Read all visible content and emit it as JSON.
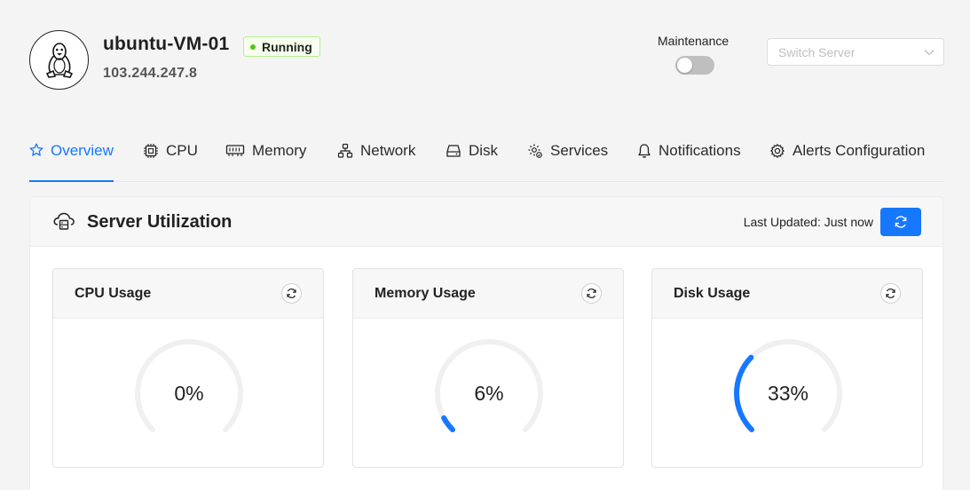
{
  "server": {
    "name": "ubuntu-VM-01",
    "status": "Running",
    "ip": "103.244.247.8",
    "avatar_icon": "linux-penguin-icon"
  },
  "header": {
    "maintenance_label": "Maintenance",
    "maintenance_on": false,
    "switch_server_placeholder": "Switch Server"
  },
  "tabs": [
    {
      "label": "Overview",
      "icon": "star-icon",
      "active": true
    },
    {
      "label": "CPU",
      "icon": "chip-icon",
      "active": false
    },
    {
      "label": "Memory",
      "icon": "memory-icon",
      "active": false
    },
    {
      "label": "Network",
      "icon": "network-icon",
      "active": false
    },
    {
      "label": "Disk",
      "icon": "disk-icon",
      "active": false
    },
    {
      "label": "Services",
      "icon": "gear-services-icon",
      "active": false
    },
    {
      "label": "Notifications",
      "icon": "bell-icon",
      "active": false
    },
    {
      "label": "Alerts Configuration",
      "icon": "gear-icon",
      "active": false
    }
  ],
  "utilization": {
    "title": "Server Utilization",
    "last_updated": "Last Updated: Just now",
    "cards": [
      {
        "title": "CPU Usage",
        "value": "0%",
        "percent": 0
      },
      {
        "title": "Memory Usage",
        "value": "6%",
        "percent": 6
      },
      {
        "title": "Disk Usage",
        "value": "33%",
        "percent": 33
      }
    ]
  },
  "colors": {
    "accent": "#1677ff",
    "running_green": "#52c41a",
    "gauge_track": "#f0f0f0"
  }
}
